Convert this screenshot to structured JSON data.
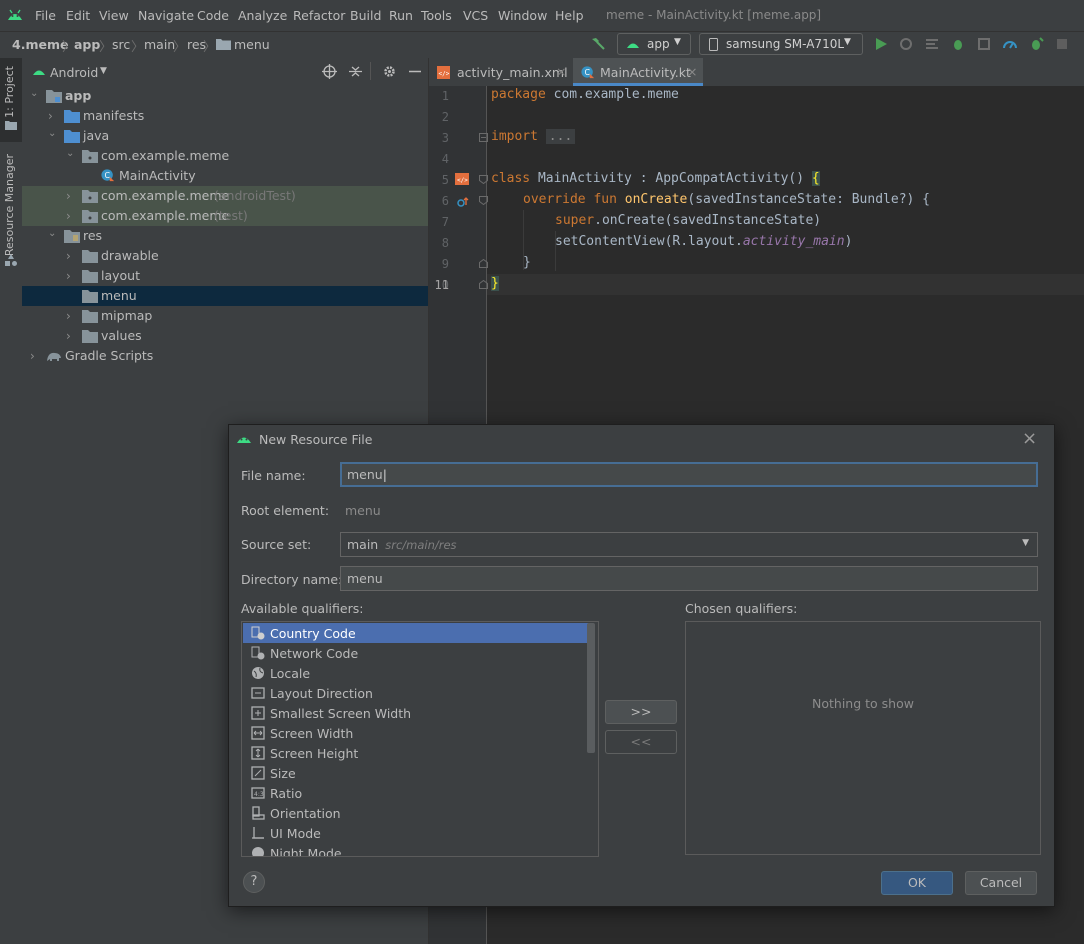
{
  "menubar": {
    "items": [
      "File",
      "Edit",
      "View",
      "Navigate",
      "Code",
      "Analyze",
      "Refactor",
      "Build",
      "Run",
      "Tools",
      "VCS",
      "Window",
      "Help"
    ],
    "window_title": "meme - MainActivity.kt [meme.app]"
  },
  "navbar": {
    "breadcrumbs": [
      "4.meme",
      "app",
      "src",
      "main",
      "res",
      "menu"
    ],
    "run_config": "app",
    "device": "samsung SM-A710L"
  },
  "left_strip": {
    "project_tab": "1: Project",
    "resource_manager_tab": "Resource Manager"
  },
  "project_panel": {
    "view_mode": "Android",
    "tree": [
      {
        "label": "app",
        "suffix": ""
      },
      {
        "label": "manifests",
        "suffix": ""
      },
      {
        "label": "java",
        "suffix": ""
      },
      {
        "label": "com.example.meme",
        "suffix": ""
      },
      {
        "label": "MainActivity",
        "suffix": ""
      },
      {
        "label": "com.example.meme",
        "suffix": "(androidTest)"
      },
      {
        "label": "com.example.meme",
        "suffix": "(test)"
      },
      {
        "label": "res",
        "suffix": ""
      },
      {
        "label": "drawable",
        "suffix": ""
      },
      {
        "label": "layout",
        "suffix": ""
      },
      {
        "label": "menu",
        "suffix": ""
      },
      {
        "label": "mipmap",
        "suffix": ""
      },
      {
        "label": "values",
        "suffix": ""
      },
      {
        "label": "Gradle Scripts",
        "suffix": ""
      }
    ]
  },
  "editor": {
    "tabs": [
      "activity_main.xml",
      "MainActivity.kt"
    ],
    "line_numbers": [
      "1",
      "2",
      "3",
      "4",
      "5",
      "6",
      "7",
      "8",
      "9",
      "10",
      "11"
    ],
    "code": {
      "l1_kw": "package",
      "l1_rest": " com.example.meme",
      "l3_kw": "import",
      "l3_fold": "...",
      "l6_kw": "class",
      "l6_rest": " MainActivity : AppCompatActivity() ",
      "l6_brace": "{",
      "l7_kw": "override fun ",
      "l7_fn": "onCreate",
      "l7_rest": "(savedInstanceState: Bundle?) {",
      "l8_kw": "super",
      "l8_rest": ".onCreate(savedInstanceState)",
      "l9_rest": "setContentView(R.layout.",
      "l9_it": "activity_main",
      "l9_end": ")",
      "l10": "}",
      "l11_brace": "}"
    }
  },
  "dialog": {
    "title": "New Resource File",
    "file_name_label": "File name:",
    "file_name_value": "menu",
    "root_element_label": "Root element:",
    "root_element_value": "menu",
    "source_set_label": "Source set:",
    "source_set_value": "main",
    "source_set_path": "src/main/res",
    "directory_name_label": "Directory name:",
    "directory_name_value": "menu",
    "available_label": "Available qualifiers:",
    "chosen_label": "Chosen qualifiers:",
    "qualifiers": [
      "Country Code",
      "Network Code",
      "Locale",
      "Layout Direction",
      "Smallest Screen Width",
      "Screen Width",
      "Screen Height",
      "Size",
      "Ratio",
      "Orientation",
      "UI Mode",
      "Night Mode"
    ],
    "add_button": ">>",
    "remove_button": "<<",
    "nothing_to_show": "Nothing to show",
    "help_button": "?",
    "ok_button": "OK",
    "cancel_button": "Cancel"
  }
}
